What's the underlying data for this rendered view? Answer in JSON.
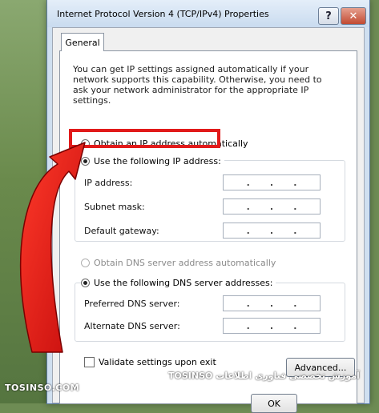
{
  "window": {
    "title": "Internet Protocol Version 4 (TCP/IPv4) Properties",
    "help_label": "?",
    "close_label": "✕"
  },
  "tabs": [
    {
      "label": "General"
    }
  ],
  "description": "You can get IP settings assigned automatically if your network supports this capability. Otherwise, you need to ask your network administrator for the appropriate IP settings.",
  "ip_section": {
    "auto_label": "Obtain an IP address automatically",
    "manual_label": "Use the following IP address:",
    "fields": [
      {
        "label": "IP address:",
        "value": ""
      },
      {
        "label": "Subnet mask:",
        "value": ""
      },
      {
        "label": "Default gateway:",
        "value": ""
      }
    ]
  },
  "dns_section": {
    "auto_label": "Obtain DNS server address automatically",
    "manual_label": "Use the following DNS server addresses:",
    "fields": [
      {
        "label": "Preferred DNS server:",
        "value": ""
      },
      {
        "label": "Alternate DNS server:",
        "value": ""
      }
    ]
  },
  "validate_label": "Validate settings upon exit",
  "advanced_label": "Advanced...",
  "ok_label": "OK",
  "watermark": {
    "left": "TOSINSO.COM",
    "right": "آموزش تخصصی فناوری اطلاعات TOSINSO"
  },
  "colors": {
    "highlight": "#e11a1a",
    "arrow": "#e11a1a"
  }
}
